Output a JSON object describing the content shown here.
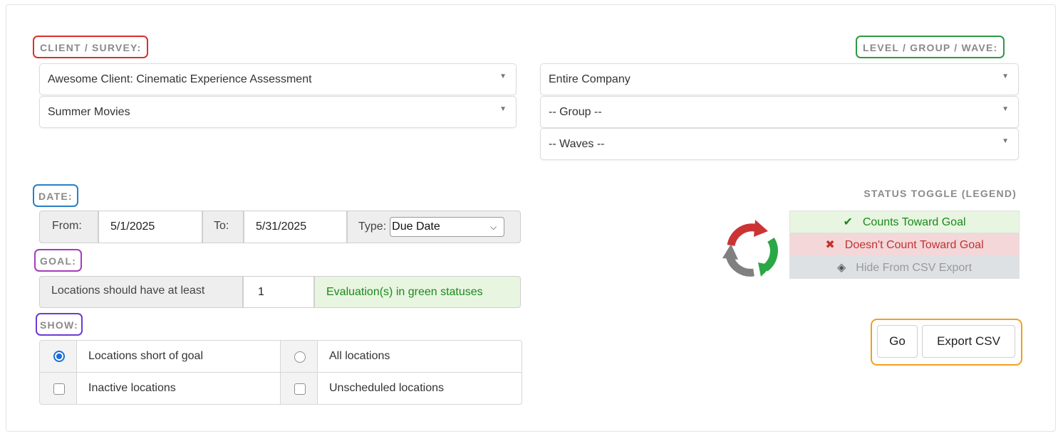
{
  "labels": {
    "client_survey": "CLIENT / SURVEY:",
    "level_group_wave": "LEVEL / GROUP / WAVE:",
    "date": "DATE:",
    "goal": "GOAL:",
    "show": "SHOW:"
  },
  "client_select": {
    "value": "Awesome Client: Cinematic Experience Assessment"
  },
  "survey_select": {
    "value": "Summer Movies"
  },
  "level_select": {
    "value": "Entire Company"
  },
  "group_select": {
    "value": "-- Group --"
  },
  "waves_select": {
    "value": "-- Waves --"
  },
  "date": {
    "from_label": "From:",
    "from_value": "5/1/2025",
    "to_label": "To:",
    "to_value": "5/31/2025",
    "type_label": "Type:",
    "type_value": "Due Date"
  },
  "goal": {
    "prefix": "Locations should have at least",
    "value": "1",
    "suffix": "Evaluation(s) in green statuses"
  },
  "show": {
    "options": [
      {
        "label": "Locations short of goal",
        "control": "radio",
        "checked": true
      },
      {
        "label": "All locations",
        "control": "radio",
        "checked": false
      },
      {
        "label": "Inactive locations",
        "control": "checkbox",
        "checked": false
      },
      {
        "label": "Unscheduled locations",
        "control": "checkbox",
        "checked": false
      }
    ]
  },
  "legend": {
    "title": "STATUS TOGGLE (LEGEND)",
    "items": [
      {
        "icon": "check-icon",
        "glyph": "✔",
        "label": "Counts Toward Goal",
        "color": "#1a8a1a"
      },
      {
        "icon": "x-icon",
        "glyph": "✖",
        "label": "Doesn't Count Toward Goal",
        "color": "#c23232"
      },
      {
        "icon": "eye-slash-icon",
        "glyph": "◈",
        "label": "Hide From CSV Export",
        "color": "#999999"
      }
    ]
  },
  "actions": {
    "go": "Go",
    "export": "Export CSV"
  },
  "colors": {
    "client_border": "#d9302c",
    "level_border": "#2d9a45",
    "date_border": "#2a7fc4",
    "goal_border": "#a53bbd",
    "show_border": "#6c3bd4",
    "actions_border": "#f0a020"
  }
}
